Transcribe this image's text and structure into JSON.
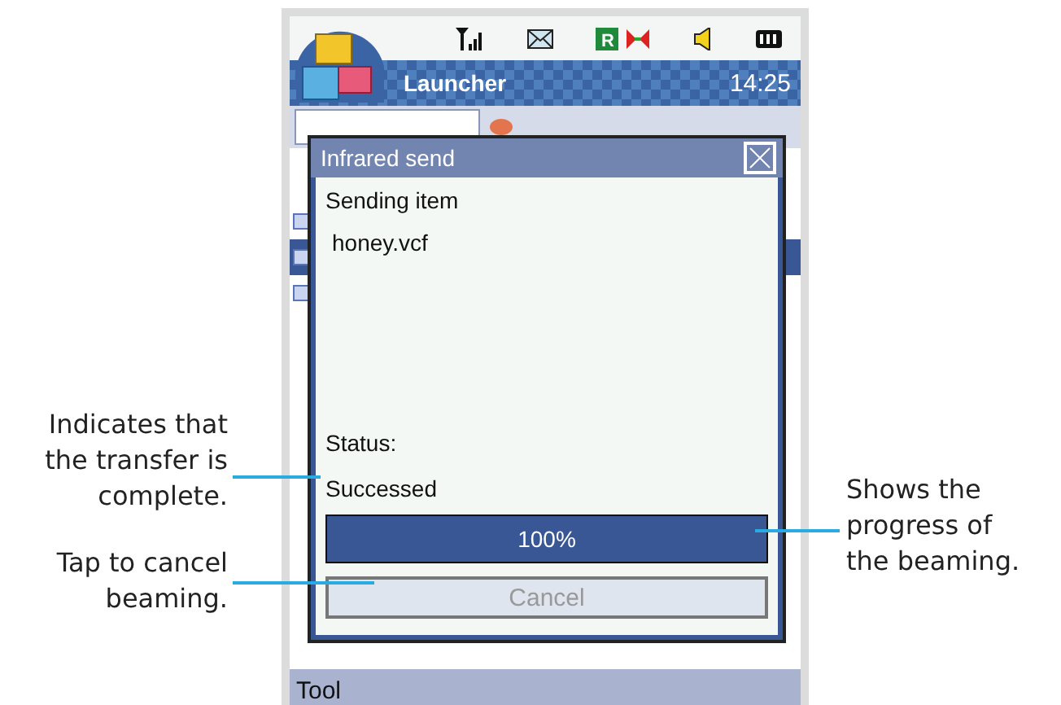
{
  "status_bar": {
    "roaming_badge": "R"
  },
  "title_bar": {
    "title": "Launcher",
    "time": "14:25"
  },
  "background_list": {
    "rows": [
      {
        "selected": false
      },
      {
        "selected": true
      },
      {
        "selected": false
      }
    ]
  },
  "dialog": {
    "title": "Infrared send",
    "heading": "Sending item",
    "file": "honey.vcf",
    "status_label": "Status:",
    "status": "Successed",
    "progress": {
      "level": 1,
      "reading": "100%"
    },
    "cancel": {
      "label": "Cancel",
      "disabled": true
    }
  },
  "toolbar": {
    "menu": "Tool"
  },
  "callouts": [
    {
      "text": "Indicates that\nthe transfer is\ncomplete."
    },
    {
      "text": "Tap to cancel\nbeaming."
    },
    {
      "text": "Shows the\nprogress of\nthe beaming."
    }
  ]
}
